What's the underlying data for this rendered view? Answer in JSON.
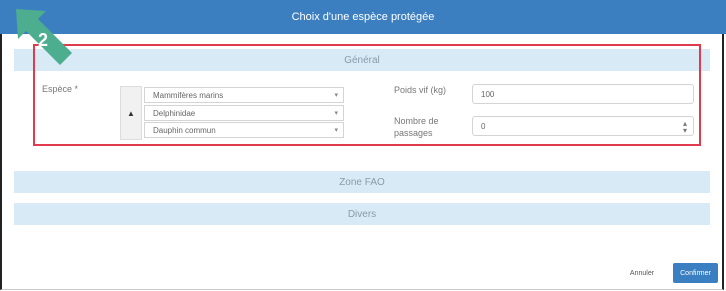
{
  "dialog": {
    "title": "Choix d'une espèce protégée"
  },
  "step_badge": {
    "number": "2",
    "color": "#4cae8e"
  },
  "sections": {
    "general": "Général",
    "zone": "Zone FAO",
    "divers": "Divers"
  },
  "form": {
    "espece_label": "Espèce *",
    "espece_selects": [
      {
        "value": "Mammifères marins"
      },
      {
        "value": "Delphinidae"
      },
      {
        "value": "Dauphin commun"
      }
    ],
    "poids_label": "Poids vif (kg)",
    "poids_value": "100",
    "nombre_label_1": "Nombre de",
    "nombre_label_2": "passages",
    "nombre_value": "0"
  },
  "buttons": {
    "cancel": "Annuler",
    "confirm": "Confirmer"
  },
  "colors": {
    "titlebar": "#3c7fc0",
    "section_header": "#d9eaf7",
    "highlight": "#e03b4c",
    "confirm": "#3a7fc1"
  }
}
